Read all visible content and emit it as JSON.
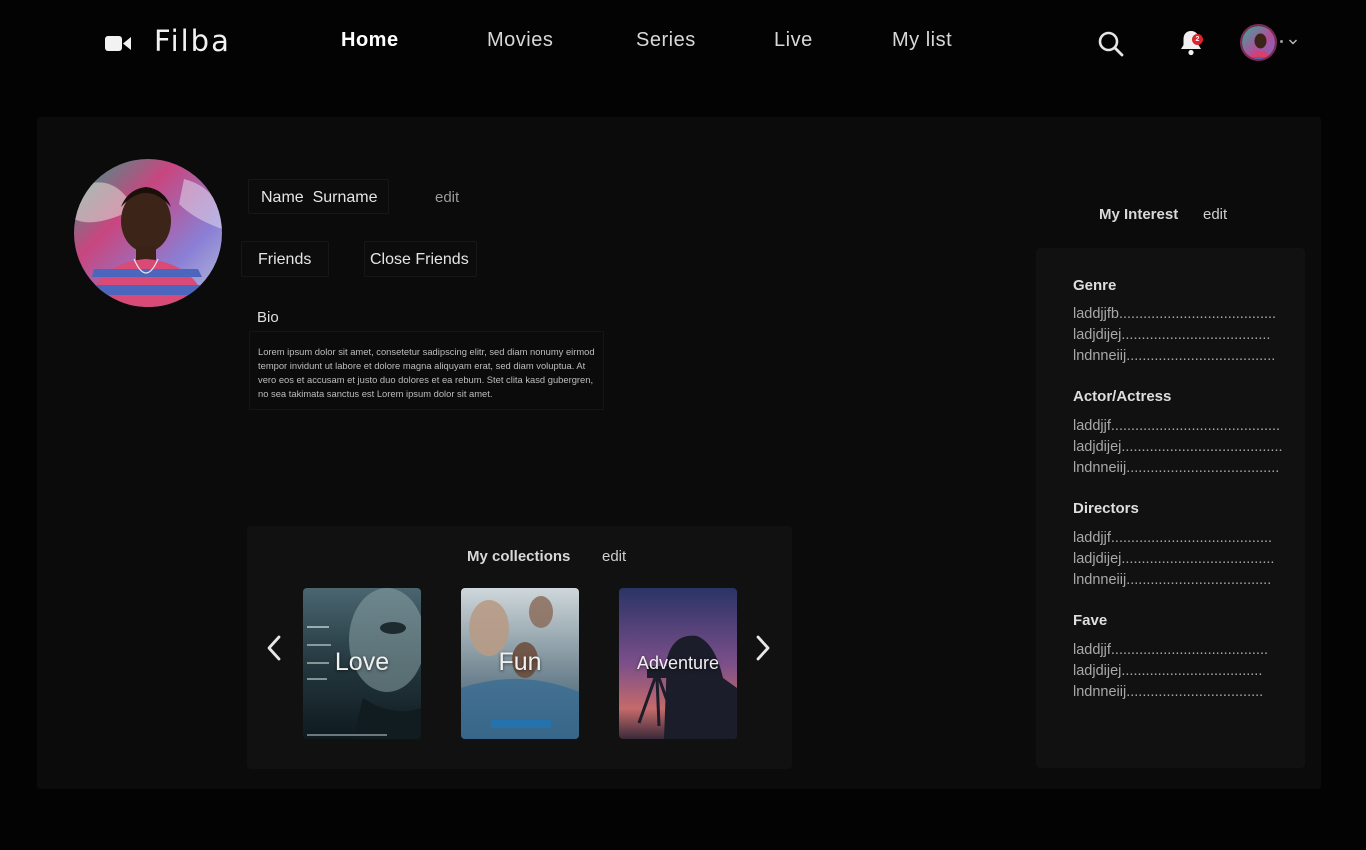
{
  "brand": {
    "name": "Filba"
  },
  "nav": {
    "links": [
      {
        "label": "Home",
        "active": true
      },
      {
        "label": "Movies"
      },
      {
        "label": "Series"
      },
      {
        "label": "Live"
      },
      {
        "label": "My list"
      }
    ],
    "notification_count": "2",
    "icons": [
      "video-camera-icon",
      "search-icon",
      "bell-icon",
      "chevron-down-icon"
    ]
  },
  "profile": {
    "name": "Name  Surname",
    "name_edit": "edit",
    "friends_label": "Friends",
    "close_friends_label": "Close Friends",
    "bio_label": "Bio",
    "bio_text": "Lorem ipsum dolor sit amet, consetetur sadipscing elitr, sed diam nonumy eirmod tempor invidunt ut labore et dolore magna aliquyam erat, sed diam voluptua. At vero eos et accusam et justo duo dolores et ea rebum. Stet clita kasd gubergren, no sea takimata sanctus est Lorem ipsum dolor sit amet."
  },
  "collections": {
    "title": "My collections",
    "edit": "edit",
    "items": [
      {
        "label": "Love"
      },
      {
        "label": "Fun"
      },
      {
        "label": "Adventure"
      }
    ]
  },
  "interest": {
    "title": "My Interest",
    "edit": "edit",
    "sections": [
      {
        "heading": "Genre",
        "items": [
          "laddjjfb.......................................",
          "ladjdijej.....................................",
          "lndnneiij....................................."
        ]
      },
      {
        "heading": "Actor/Actress",
        "items": [
          "laddjjf..........................................",
          "ladjdijej........................................",
          "lndnneiij......................................"
        ]
      },
      {
        "heading": "Directors",
        "items": [
          "laddjjf........................................",
          "ladjdijej......................................",
          "lndnneiij...................................."
        ]
      },
      {
        "heading": "Fave",
        "items": [
          "laddjjf.......................................",
          "ladjdijej...................................",
          "lndnneiij.................................."
        ]
      }
    ]
  },
  "colors": {
    "background": "#030303",
    "panel": "#0b0b0b",
    "card": "#111111",
    "badge": "#e1222a"
  }
}
